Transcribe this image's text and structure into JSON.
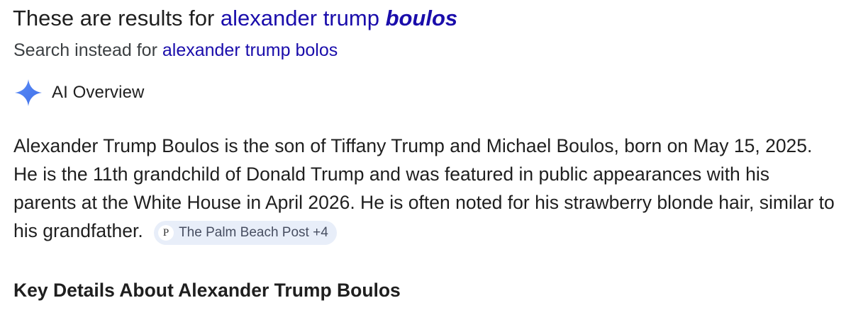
{
  "spelling": {
    "prefix": "These are results for",
    "corrected_normal": "alexander trump",
    "corrected_emphasis": "boulos"
  },
  "search_instead": {
    "prefix": "Search instead for",
    "original_query": "alexander trump bolos"
  },
  "ai_overview": {
    "label": "AI Overview",
    "icon": "sparkle-icon",
    "accent_color": "#4c7ff5",
    "paragraph": "Alexander Trump Boulos is the son of Tiffany Trump and Michael Boulos, born on May 15, 2025. He is the 11th grandchild of Donald Trump and was featured in public appearances with his parents at the White House in April 2026. He is often noted for his strawberry blonde hair, similar to his grandfather.",
    "citation": {
      "favicon_letter": "P",
      "source": "The Palm Beach Post +4"
    }
  },
  "section_heading": "Key Details About Alexander Trump Boulos",
  "colors": {
    "link": "#1a0dab",
    "text": "#1f1f1f",
    "citation_bg": "#e8eef9"
  }
}
